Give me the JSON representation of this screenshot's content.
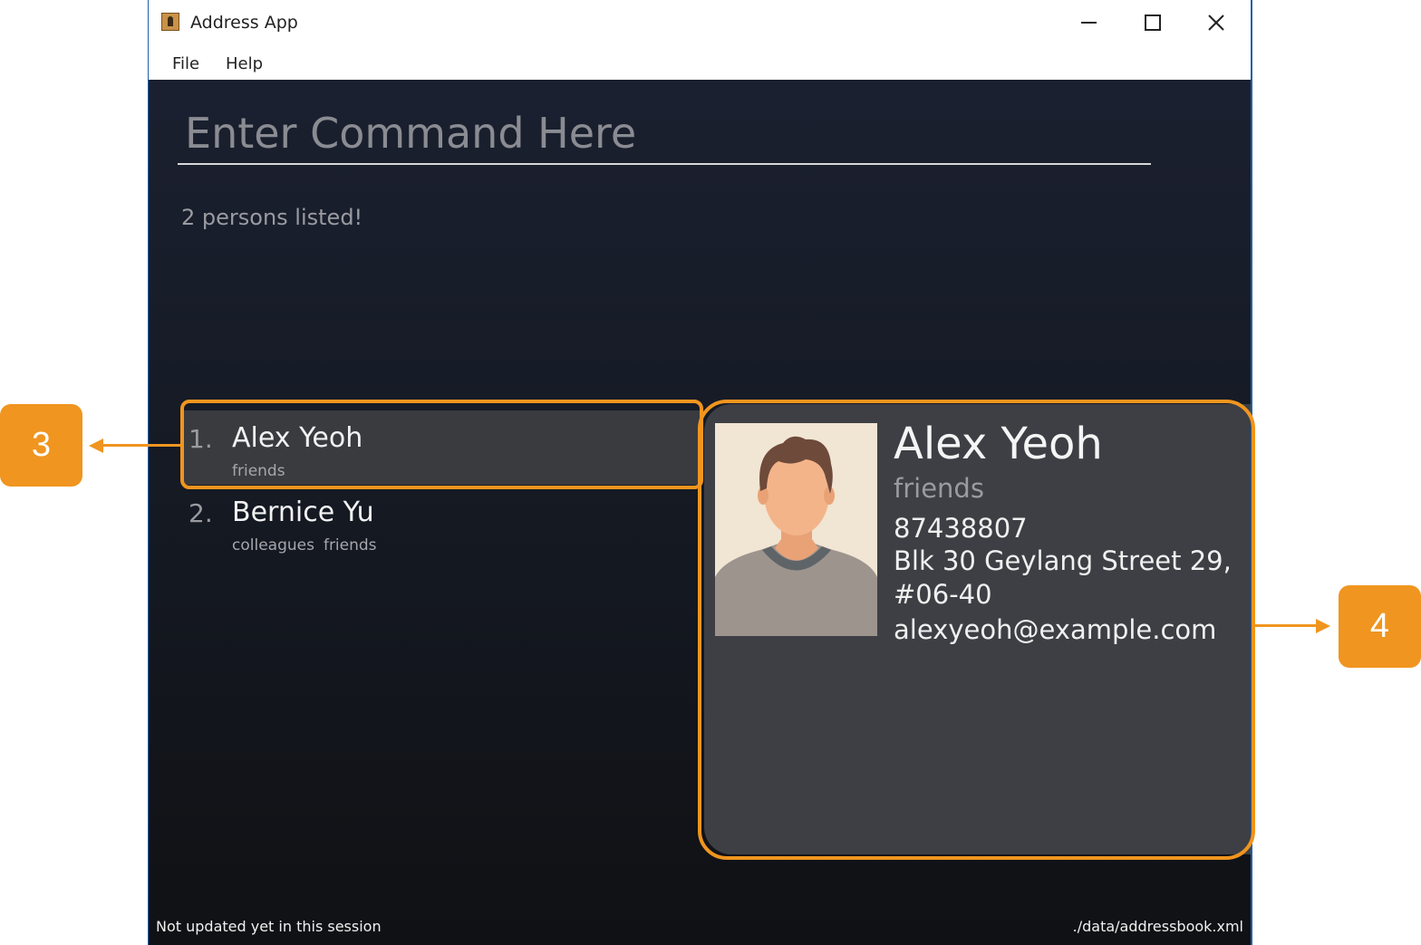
{
  "window": {
    "title": "Address App",
    "icon": "address-book-icon",
    "controls": [
      "minimize-icon",
      "maximize-icon",
      "close-icon"
    ]
  },
  "menu": {
    "file": "File",
    "help": "Help"
  },
  "command": {
    "placeholder": "Enter Command Here",
    "value": ""
  },
  "result": "2 persons listed!",
  "persons": [
    {
      "index": "1.",
      "name": "Alex Yeoh",
      "tags": [
        "friends"
      ]
    },
    {
      "index": "2.",
      "name": "Bernice Yu",
      "tags": [
        "colleagues",
        "friends"
      ]
    }
  ],
  "detail": {
    "name": "Alex Yeoh",
    "tags": "friends",
    "phone": "87438807",
    "address": "Blk 30 Geylang Street 29, #06-40",
    "email": "alexyeoh@example.com",
    "photo": "person-avatar-icon"
  },
  "status": {
    "sync": "Not updated yet in this session",
    "file": "./data/addressbook.xml"
  },
  "annotations": {
    "label3": "3",
    "label4": "4",
    "color": "#f0951f"
  },
  "colors": {
    "background_top": "#1b2030",
    "background_bottom": "#101114",
    "selected_card": "#3a3b3f",
    "detail_panel": "#3d3f44",
    "accent": "#f0951f"
  }
}
